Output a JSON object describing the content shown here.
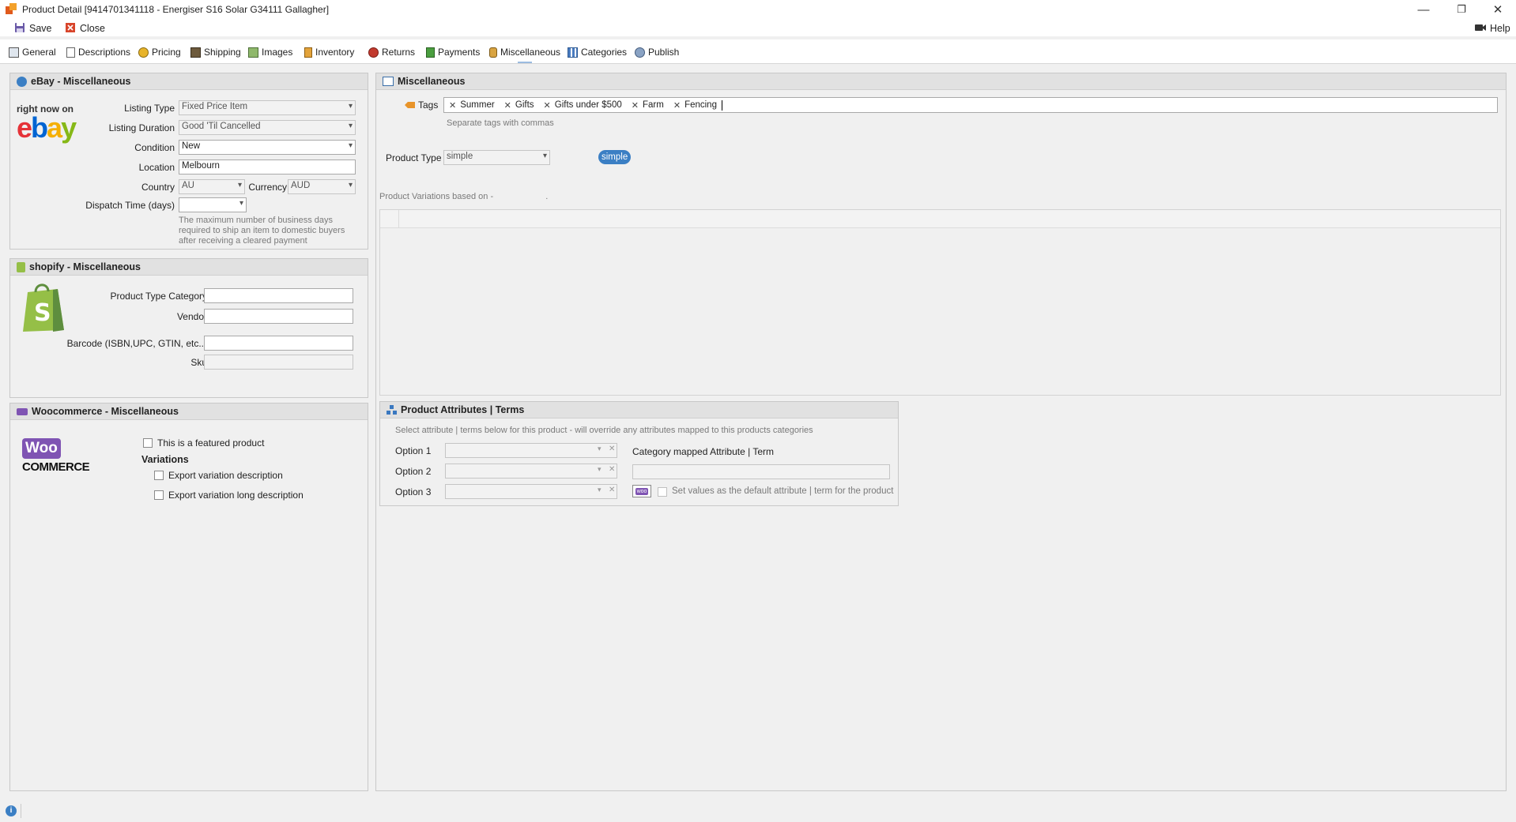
{
  "window": {
    "title": "Product Detail [9414701341118 - Energiser S16 Solar G34111 Gallagher]",
    "minimize": "—",
    "restore": "❐",
    "close": "✕"
  },
  "toolbar": {
    "save": "Save",
    "close": "Close",
    "help": "Help"
  },
  "tabs": [
    {
      "label": "General",
      "icon": "general-icon"
    },
    {
      "label": "Descriptions",
      "icon": "descriptions-icon"
    },
    {
      "label": "Pricing",
      "icon": "pricing-icon"
    },
    {
      "label": "Shipping",
      "icon": "shipping-icon"
    },
    {
      "label": "Images",
      "icon": "images-icon"
    },
    {
      "label": "Inventory",
      "icon": "inventory-icon"
    },
    {
      "label": "Returns",
      "icon": "returns-icon"
    },
    {
      "label": "Payments",
      "icon": "payments-icon"
    },
    {
      "label": "Miscellaneous",
      "icon": "miscellaneous-icon"
    },
    {
      "label": "Categories",
      "icon": "categories-icon"
    },
    {
      "label": "Publish",
      "icon": "publish-icon"
    }
  ],
  "ebay": {
    "header": "eBay - Miscellaneous",
    "logo_tagline": "right now on",
    "logo_letters": [
      "e",
      "b",
      "a",
      "y"
    ],
    "listing_type_label": "Listing Type",
    "listing_type": "Fixed Price Item",
    "listing_duration_label": "Listing Duration",
    "listing_duration": "Good 'Til Cancelled",
    "condition_label": "Condition",
    "condition": "New",
    "location_label": "Location",
    "location": "Melbourn",
    "country_label": "Country",
    "country": "AU",
    "currency_label": "Currency",
    "currency": "AUD",
    "dispatch_label": "Dispatch Time (days)",
    "dispatch": "",
    "dispatch_hint": "The maximum number of business days required to ship an item to domestic buyers after receiving a cleared payment"
  },
  "shopify": {
    "header": "shopify - Miscellaneous",
    "product_type_category_label": "Product Type Category",
    "product_type_category": "",
    "vendor_label": "Vendor",
    "vendor": "",
    "barcode_label": "Barcode (ISBN,UPC, GTIN, etc..)",
    "barcode": "",
    "sku_label": "Sku",
    "sku": ""
  },
  "woo": {
    "header": "Woocommerce - Miscellaneous",
    "logo_top": "Woo",
    "logo_bottom": "COMMERCE",
    "featured_label": "This is a featured product",
    "featured": false,
    "variations_title": "Variations",
    "export_desc_label": "Export variation description",
    "export_desc": false,
    "export_long_label": "Export variation long description",
    "export_long": false
  },
  "misc": {
    "header": "Miscellaneous",
    "tags_label": "Tags",
    "tags": [
      "Summer",
      "Gifts",
      "Gifts under $500",
      "Farm",
      "Fencing"
    ],
    "tags_hint": "Separate tags with commas",
    "product_type_label": "Product Type",
    "product_type": "simple",
    "product_type_badge": "simple",
    "variations_label": "Product Variations based on -",
    "variations_suffix": "."
  },
  "attributes": {
    "header": "Product Attributes | Terms",
    "hint": "Select attribute | terms below for this product - will override any attributes mapped to this products categories",
    "options": [
      {
        "label": "Option 1",
        "value": ""
      },
      {
        "label": "Option 2",
        "value": ""
      },
      {
        "label": "Option 3",
        "value": ""
      }
    ],
    "category_mapped_label": "Category mapped Attribute | Term",
    "category_mapped_value": "",
    "default_label": "Set values as the default attribute | term for the product",
    "woo_badge": "woo"
  },
  "status": {
    "info_icon": "i"
  },
  "colors": {
    "badge_blue": "#3b7fc4",
    "ebay_red": "#e53238",
    "ebay_blue": "#0064d2",
    "ebay_yellow": "#f5af02",
    "ebay_green": "#86b817",
    "shopify_green": "#95bf47",
    "woo_purple": "#7f54b3"
  }
}
